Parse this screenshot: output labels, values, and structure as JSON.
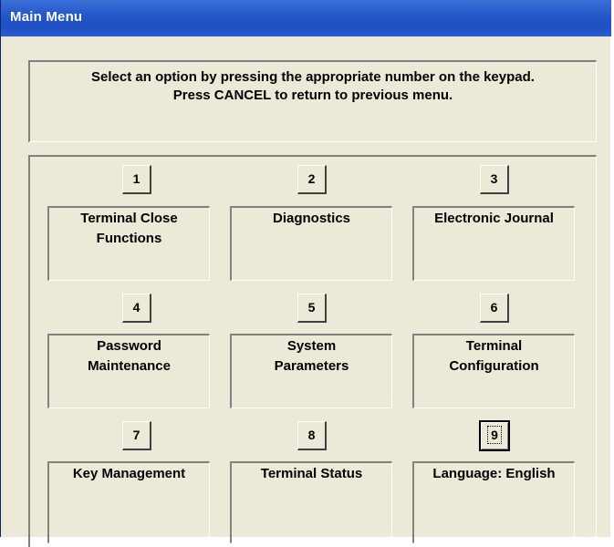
{
  "window": {
    "title": "Main Menu"
  },
  "instructions": {
    "line1": "Select an option by pressing the appropriate number on the keypad.",
    "line2": "Press CANCEL to return to previous menu."
  },
  "options": [
    {
      "key": "1",
      "label": "Terminal Close\nFunctions"
    },
    {
      "key": "2",
      "label": "Diagnostics"
    },
    {
      "key": "3",
      "label": "Electronic Journal"
    },
    {
      "key": "4",
      "label": "Password\nMaintenance"
    },
    {
      "key": "5",
      "label": "System\nParameters"
    },
    {
      "key": "6",
      "label": "Terminal\nConfiguration"
    },
    {
      "key": "7",
      "label": "Key Management"
    },
    {
      "key": "8",
      "label": "Terminal Status"
    },
    {
      "key": "9",
      "label": "Language: English"
    }
  ],
  "focused_key": "9",
  "colors": {
    "titlebar": "#2456c8",
    "window_bg": "#ece9d8"
  }
}
